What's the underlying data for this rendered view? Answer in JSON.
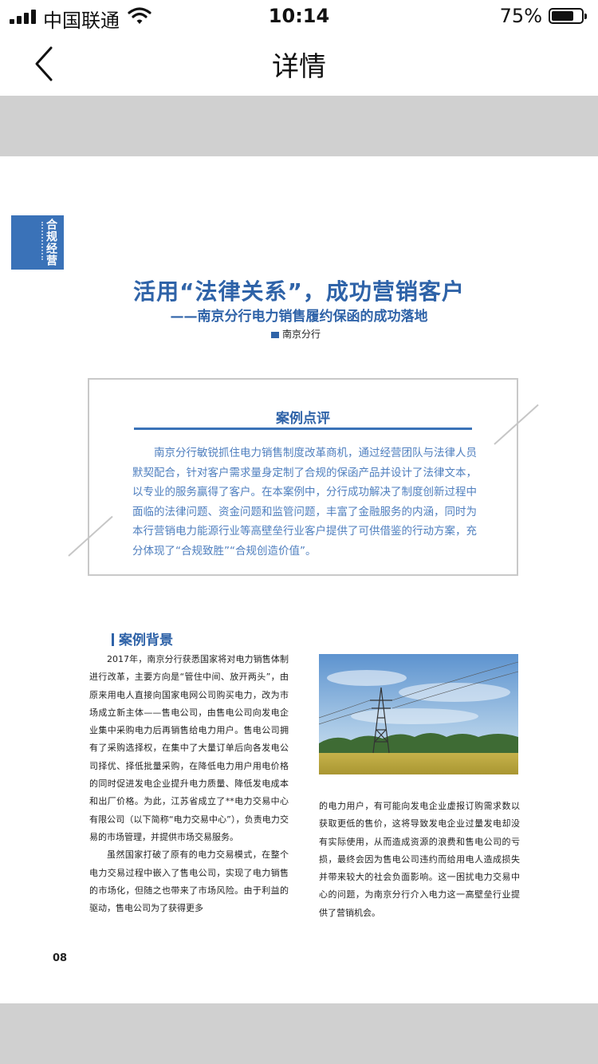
{
  "status_bar": {
    "carrier": "中国联通",
    "time": "10:14",
    "battery": "75%",
    "battery_level": 0.75
  },
  "nav": {
    "back_icon": "chevron-left-icon",
    "title": "详情"
  },
  "document": {
    "side_tab": "合规经营",
    "title": "活用“法律关系”，成功营销客户",
    "subtitle": "——南京分行电力销售履约保函的成功落地",
    "author": "南京分行",
    "review": {
      "heading": "案例点评",
      "text": "南京分行敏锐抓住电力销售制度改革商机，通过经营团队与法律人员默契配合，针对客户需求量身定制了合规的保函产品并设计了法律文本，以专业的服务赢得了客户。在本案例中，分行成功解决了制度创新过程中面临的法律问题、资金问题和监管问题，丰富了金融服务的内涵，同时为本行营销电力能源行业等高壁垒行业客户提供了可供借鉴的行动方案，充分体现了“合规致胜”“合规创造价值”。"
    },
    "section": {
      "heading": "案例背景",
      "left_p1": "2017年，南京分行获悉国家将对电力销售体制进行改革，主要方向是“管住中间、放开两头”，由原来用电人直接向国家电网公司购买电力，改为市场成立新主体——售电公司，由售电公司向发电企业集中采购电力后再销售给电力用户。售电公司拥有了采购选择权，在集中了大量订单后向各发电公司择优、择低批量采购，在降低电力用户用电价格的同时促进发电企业提升电力质量、降低发电成本和出厂价格。为此，江苏省成立了**电力交易中心有限公司（以下简称“电力交易中心”），负责电力交易的市场管理，并提供市场交易服务。",
      "left_p2": "虽然国家打破了原有的电力交易模式，在整个电力交易过程中嵌入了售电公司，实现了电力销售的市场化，但随之也带来了市场风险。由于利益的驱动，售电公司为了获得更多",
      "right_p1": "的电力用户，有可能向发电企业虚报订购需求数以获取更低的售价，这将导致发电企业过量发电却没有实际使用，从而造成资源的浪费和售电公司的亏损，最终会因为售电公司违约而给用电人造成损失并带来较大的社会负面影响。这一困扰电力交易中心的问题，为南京分行介入电力这一高壁垒行业提供了营销机会。"
    },
    "page_number": "08"
  },
  "colors": {
    "accent": "#2f63a8",
    "review_text": "#4f7fbf",
    "gray_band": "#d0d0d0"
  }
}
